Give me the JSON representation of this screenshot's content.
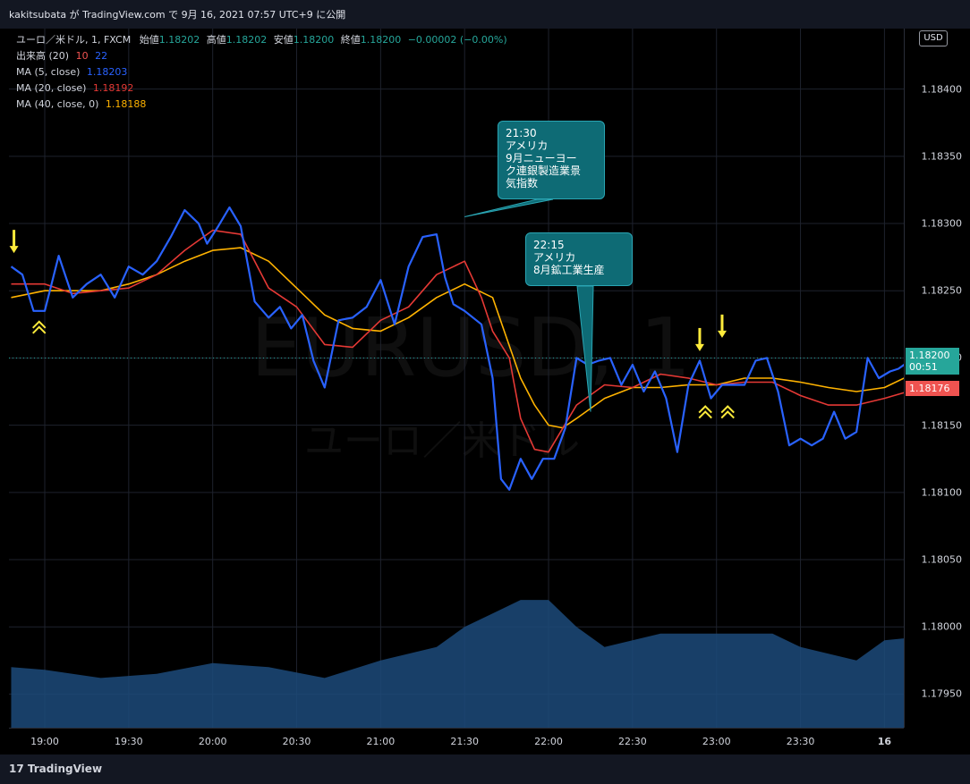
{
  "header": {
    "publish_line": "kakitsubata が TradingView.com で 9月 16, 2021 07:57 UTC+9 に公開"
  },
  "legend": {
    "symbol": "ユーロ／米ドル, 1, FXCM",
    "o_label": "始値",
    "o_value": "1.18202",
    "h_label": "高値",
    "h_value": "1.18202",
    "l_label": "安値",
    "l_value": "1.18200",
    "c_label": "終値",
    "c_value": "1.18200",
    "change": "−0.00002 (−0.00%)",
    "volume_label": "出来高 (20)",
    "volume_a": "10",
    "volume_b": "22",
    "ma5_label": "MA (5, close)",
    "ma5_value": "1.18203",
    "ma20_label": "MA (20, close)",
    "ma20_value": "1.18192",
    "ma40_label": "MA (40, close, 0)",
    "ma40_value": "1.18188"
  },
  "currency_button": "USD",
  "price_tags": {
    "last_price": "1.18200",
    "countdown": "00:51",
    "ma_price": "1.18176",
    "last_color": "#26a69a",
    "ma_color": "#ef5350"
  },
  "watermark": {
    "symbol": "EURUSD, 1",
    "name": "ユーロ／米ドル"
  },
  "callouts": [
    {
      "lines": [
        "21:30",
        "アメリカ",
        "9月ニューヨー",
        "ク連銀製造業景",
        "気指数"
      ]
    },
    {
      "lines": [
        "22:15",
        "アメリカ",
        "8月鉱工業生産"
      ]
    }
  ],
  "footer": {
    "brand": "TradingView"
  },
  "colors": {
    "up": "#26a69a",
    "down": "#ef5350",
    "ma5": "#2962ff",
    "ma20": "#e53935",
    "ma40": "#ffb300",
    "volume": "#1c4a7a"
  },
  "chart_data": {
    "type": "line",
    "title": "",
    "ylim": [
      1.17925,
      1.18445
    ],
    "y_ticks": [
      "1.18400",
      "1.18350",
      "1.18300",
      "1.18250",
      "1.18200",
      "1.18150",
      "1.18100",
      "1.18050",
      "1.18000",
      "1.17950"
    ],
    "x_ticks": [
      "19:00",
      "19:30",
      "20:00",
      "20:30",
      "21:00",
      "21:30",
      "22:00",
      "22:30",
      "23:00",
      "23:30",
      "16"
    ],
    "x_minutes": [
      0,
      30,
      60,
      90,
      120,
      150,
      180,
      210,
      240,
      270,
      300
    ],
    "series": [
      {
        "key": "ma5",
        "x": [
          -12,
          -8,
          -4,
          0,
          5,
          10,
          15,
          20,
          25,
          30,
          35,
          40,
          45,
          50,
          55,
          58,
          62,
          66,
          70,
          75,
          80,
          84,
          88,
          92,
          96,
          100,
          105,
          110,
          115,
          120,
          125,
          130,
          135,
          140,
          143,
          146,
          150,
          153,
          156,
          160,
          163,
          166,
          170,
          174,
          178,
          182,
          186,
          190,
          194,
          198,
          202,
          206,
          210,
          214,
          218,
          222,
          226,
          230,
          234,
          238,
          242,
          246,
          250,
          254,
          258,
          262,
          266,
          270,
          274,
          278,
          282,
          286,
          290,
          294,
          298,
          302,
          305,
          307,
          310
        ],
        "values": [
          1.18268,
          1.18262,
          1.18235,
          1.18235,
          1.18276,
          1.18245,
          1.18255,
          1.18262,
          1.18245,
          1.18268,
          1.18262,
          1.18272,
          1.1829,
          1.1831,
          1.183,
          1.18285,
          1.18298,
          1.18312,
          1.18298,
          1.18242,
          1.1823,
          1.18238,
          1.18222,
          1.18232,
          1.18198,
          1.18178,
          1.18228,
          1.1823,
          1.18238,
          1.18258,
          1.18225,
          1.18268,
          1.1829,
          1.18292,
          1.1826,
          1.1824,
          1.18235,
          1.1823,
          1.18225,
          1.18185,
          1.1811,
          1.18102,
          1.18125,
          1.1811,
          1.18125,
          1.18125,
          1.18148,
          1.182,
          1.18195,
          1.18198,
          1.182,
          1.1818,
          1.18195,
          1.18175,
          1.1819,
          1.1817,
          1.1813,
          1.1818,
          1.18198,
          1.1817,
          1.1818,
          1.1818,
          1.1818,
          1.18198,
          1.182,
          1.18175,
          1.18135,
          1.1814,
          1.18135,
          1.1814,
          1.1816,
          1.1814,
          1.18145,
          1.182,
          1.18185,
          1.1819,
          1.18192,
          1.18195,
          1.182
        ]
      },
      {
        "key": "ma20",
        "x": [
          -12,
          0,
          10,
          20,
          30,
          40,
          50,
          60,
          70,
          80,
          90,
          100,
          110,
          120,
          130,
          140,
          150,
          156,
          160,
          166,
          170,
          175,
          180,
          190,
          200,
          210,
          220,
          230,
          240,
          250,
          260,
          270,
          280,
          290,
          300,
          310
        ],
        "values": [
          1.18255,
          1.18255,
          1.18248,
          1.1825,
          1.18252,
          1.18262,
          1.1828,
          1.18295,
          1.18292,
          1.18252,
          1.18238,
          1.1821,
          1.18208,
          1.18228,
          1.18238,
          1.18262,
          1.18272,
          1.18245,
          1.1822,
          1.182,
          1.18155,
          1.18132,
          1.1813,
          1.18165,
          1.1818,
          1.18178,
          1.18188,
          1.18185,
          1.1818,
          1.18182,
          1.18182,
          1.18172,
          1.18165,
          1.18165,
          1.1817,
          1.18176
        ]
      },
      {
        "key": "ma40",
        "x": [
          -12,
          0,
          10,
          20,
          30,
          40,
          50,
          60,
          70,
          80,
          90,
          100,
          110,
          120,
          130,
          140,
          150,
          160,
          165,
          170,
          175,
          180,
          185,
          190,
          200,
          210,
          220,
          230,
          240,
          250,
          260,
          270,
          280,
          290,
          300,
          310
        ],
        "values": [
          1.18245,
          1.1825,
          1.1825,
          1.1825,
          1.18255,
          1.18262,
          1.18272,
          1.1828,
          1.18282,
          1.18272,
          1.18252,
          1.18232,
          1.18222,
          1.1822,
          1.1823,
          1.18245,
          1.18255,
          1.18245,
          1.18215,
          1.18185,
          1.18165,
          1.1815,
          1.18148,
          1.18155,
          1.1817,
          1.18178,
          1.18178,
          1.1818,
          1.1818,
          1.18185,
          1.18185,
          1.18182,
          1.18178,
          1.18175,
          1.18178,
          1.18188
        ]
      },
      {
        "key": "volume_ma",
        "x": [
          -12,
          0,
          20,
          40,
          60,
          80,
          100,
          120,
          140,
          150,
          160,
          170,
          180,
          190,
          200,
          210,
          220,
          240,
          260,
          270,
          280,
          290,
          300,
          310
        ],
        "values": [
          1.1797,
          1.17968,
          1.17962,
          1.17965,
          1.17973,
          1.1797,
          1.17962,
          1.17975,
          1.17985,
          1.18,
          1.1801,
          1.1802,
          1.1802,
          1.18,
          1.17985,
          1.1799,
          1.17995,
          1.17995,
          1.17995,
          1.17985,
          1.1798,
          1.17975,
          1.1799,
          1.17992
        ]
      }
    ],
    "markers": [
      {
        "kind": "arrow-down",
        "x": -11,
        "y": 1.18278
      },
      {
        "kind": "arrow-down",
        "x": 234,
        "y": 1.18205
      },
      {
        "kind": "arrow-down",
        "x": 242,
        "y": 1.18215
      },
      {
        "kind": "chevron-up",
        "x": -2,
        "y": 1.18225
      },
      {
        "kind": "chevron-up",
        "x": 236,
        "y": 1.18162
      },
      {
        "kind": "chevron-up",
        "x": 244,
        "y": 1.18162
      }
    ],
    "callout_anchor_x": [
      150,
      195
    ],
    "callout_anchor_y": [
      1.18305,
      1.1816
    ]
  }
}
